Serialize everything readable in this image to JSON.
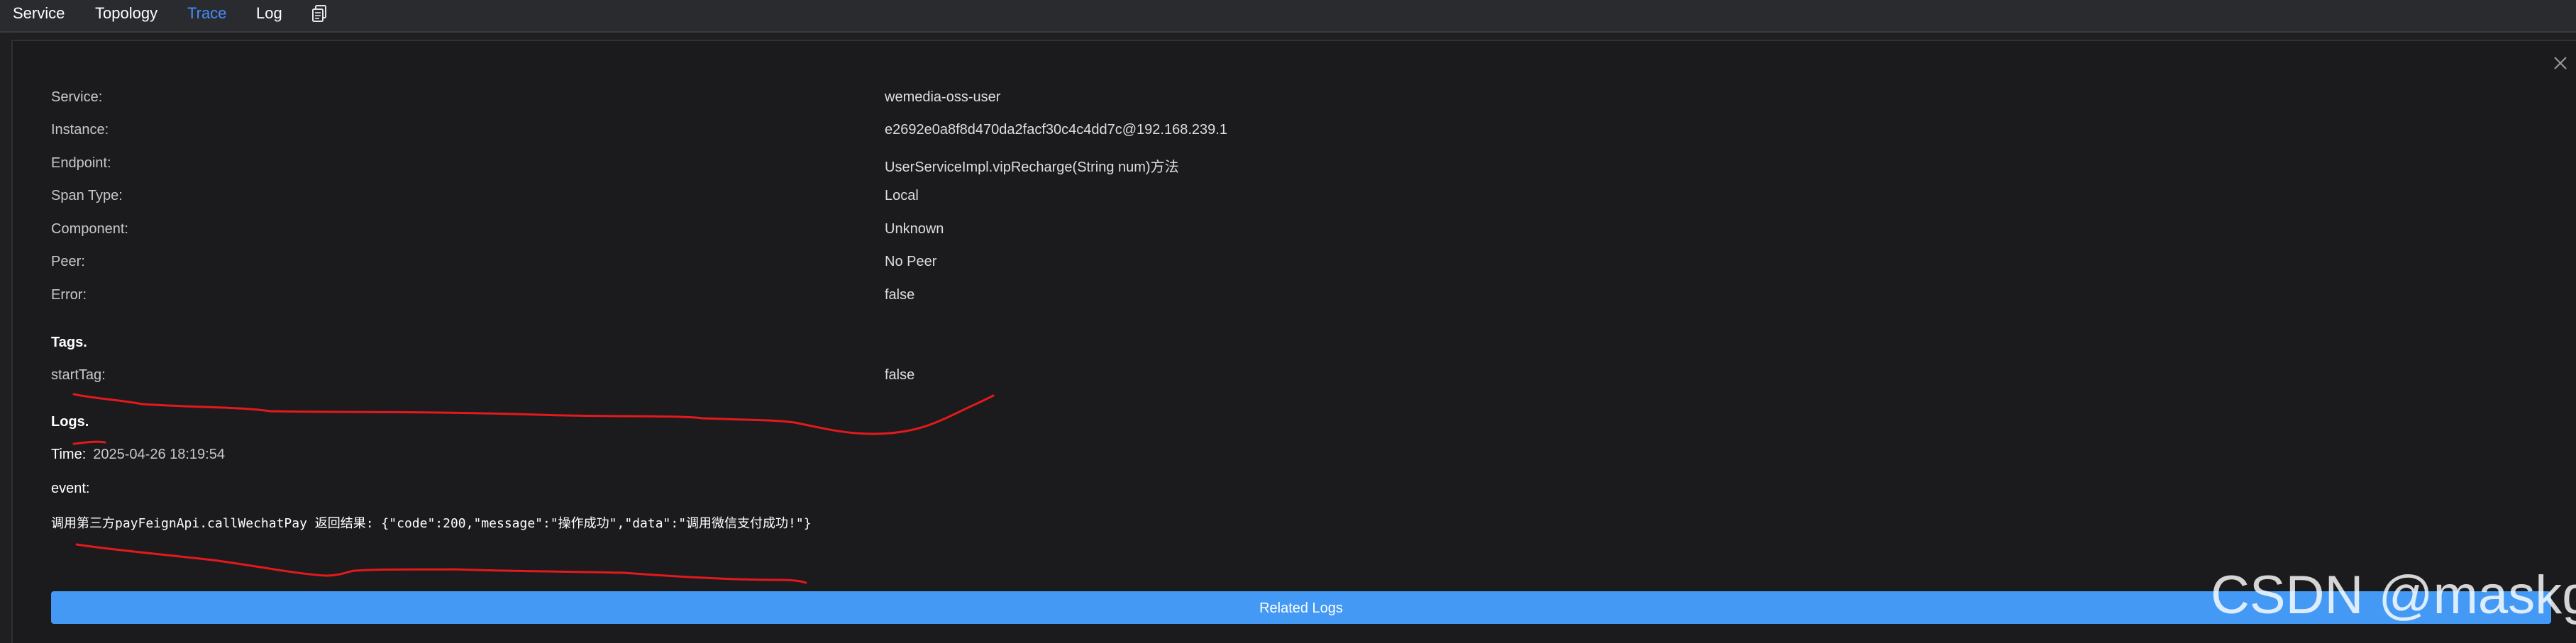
{
  "nav": {
    "items": [
      {
        "label": "Service",
        "active": false
      },
      {
        "label": "Topology",
        "active": false
      },
      {
        "label": "Trace",
        "active": true
      },
      {
        "label": "Log",
        "active": false
      }
    ],
    "copy_icon": "copy-icon",
    "active_color": "#448dfe"
  },
  "detail": {
    "fields": [
      {
        "label": "Service:",
        "value": "wemedia-oss-user"
      },
      {
        "label": "Instance:",
        "value": "e2692e0a8f8d470da2facf30c4c4dd7c@192.168.239.1"
      },
      {
        "label": "Endpoint:",
        "value": "UserServiceImpl.vipRecharge(String num)方法"
      },
      {
        "label": "Span Type:",
        "value": "Local"
      },
      {
        "label": "Component:",
        "value": "Unknown"
      },
      {
        "label": "Peer:",
        "value": "No Peer"
      },
      {
        "label": "Error:",
        "value": "false"
      }
    ],
    "close_icon": "close-icon"
  },
  "tags": {
    "title": "Tags.",
    "items": [
      {
        "label": "startTag:",
        "value": "false"
      }
    ]
  },
  "logs": {
    "title": "Logs.",
    "time_label": "Time:",
    "time_value": "2025-04-26 18:19:54",
    "event_label": "event:",
    "message": "调用第三方payFeignApi.callWechatPay 返回结果: {\"code\":200,\"message\":\"操作成功\",\"data\":\"调用微信支付成功!\"}"
  },
  "related_logs_button": "Related Logs",
  "watermark": "CSDN @maskge",
  "colors": {
    "accent": "#4499f5",
    "annotation_red": "#e3191c"
  }
}
